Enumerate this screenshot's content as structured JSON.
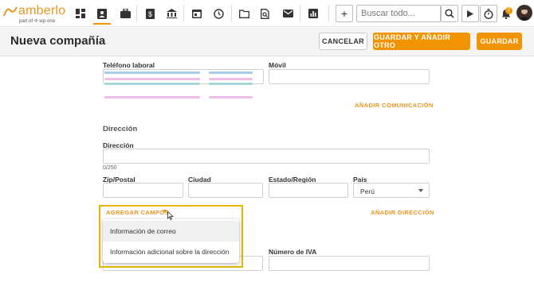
{
  "app": {
    "logo_text": "amberlo",
    "logo_sub": "part of ✢ wp·one"
  },
  "topbar": {
    "nav_icons": [
      "dashboard-icon",
      "contacts-icon",
      "briefcase-icon",
      "invoice-icon",
      "bank-icon",
      "calendar-icon",
      "history-icon",
      "folder-icon",
      "document-search-icon",
      "mail-icon",
      "reports-icon"
    ],
    "add_icon": "+",
    "search_placeholder": "Buscar todo...",
    "notification_count": "2"
  },
  "header": {
    "title": "Nueva compañía",
    "cancel_label": "CANCELAR",
    "save_add_label": "GUARDAR Y AÑADIR OTRO",
    "save_label": "GUARDAR"
  },
  "form": {
    "work_phone_label": "Teléfono laboral",
    "mobile_label": "Móvil",
    "add_communication": "AÑADIR COMUNICACIÓN",
    "address_section": "Dirección",
    "address_label": "Dirección",
    "address_counter": "0/250",
    "zip_label": "Zip/Postal",
    "city_label": "Ciudad",
    "state_label": "Estado/Región",
    "country_label": "País",
    "country_value": "Perú",
    "add_fields": "AGREGAR CAMPOS",
    "add_address": "AÑADIR DIRECCIÓN",
    "vat_label": "Número de IVA"
  },
  "dropdown": {
    "items": [
      "Información de correo",
      "Información adicional sobre la dirección"
    ]
  },
  "colors": {
    "accent": "#f29400",
    "highlight": "#e8b400"
  }
}
